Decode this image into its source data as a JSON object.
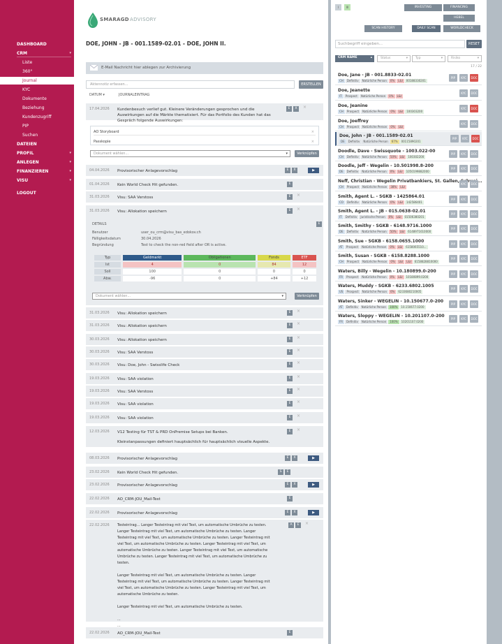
{
  "sidebar": {
    "items": [
      {
        "label": "DASHBOARD",
        "type": "main"
      },
      {
        "label": "CRM",
        "type": "main",
        "arrow": true
      },
      {
        "label": "Liste",
        "type": "sub"
      },
      {
        "label": "360°",
        "type": "sub"
      },
      {
        "label": "Journal",
        "type": "sub",
        "active": true
      },
      {
        "label": "KYC",
        "type": "sub"
      },
      {
        "label": "Dokumente",
        "type": "sub"
      },
      {
        "label": "Beziehung",
        "type": "sub"
      },
      {
        "label": "Kundenzugriff",
        "type": "sub"
      },
      {
        "label": "PIP",
        "type": "sub"
      },
      {
        "label": "Suchen",
        "type": "sub"
      },
      {
        "label": "DATEIEN",
        "type": "main"
      },
      {
        "label": "PROFIL",
        "type": "main",
        "arrow": true
      },
      {
        "label": "ANLEGEN",
        "type": "main",
        "arrow": true
      },
      {
        "label": "FINANZIEREN",
        "type": "main",
        "arrow": true
      },
      {
        "label": "VISU",
        "type": "main",
        "arrow": true
      },
      {
        "label": "LOGOUT",
        "type": "main",
        "gap": true
      }
    ]
  },
  "logo": {
    "brand": "SMARAGD",
    "suffix": "ADVISORY"
  },
  "page": {
    "title": "DOE, JOHN - JB - 001.1589-02.01 - DOE, JOHN II."
  },
  "banner": {
    "text": "E-Mail Nachricht hier ablegen zur Archivierung"
  },
  "note": {
    "placeholder": "Aktennotiz erfassen...",
    "create": "ERSTELLEN"
  },
  "table_head": {
    "date": "DATUM",
    "entry": "JOURNALEINTRAG"
  },
  "journal": [
    {
      "date": "17.04.2026",
      "text": "Kundenbesuch verlief gut. Kleinere Veränderungen gesprochen und die Auswirkungen auf die Märkte thematisiert. Für das Portfolio des Kunden hat das Gespräch folgende Auswirkungen:",
      "icons": [
        "E",
        "X"
      ],
      "expanded": "docs"
    },
    {
      "date": "04.04.2026",
      "text": "Provisorischer Anlagevorschlag",
      "icons": [
        "E",
        "X"
      ],
      "play": true
    },
    {
      "date": "01.04.2026",
      "text": "Kein World Check Hit gefunden.",
      "icons": [
        "E"
      ]
    },
    {
      "date": "31.03.2026",
      "text": "Visu: SAA Verstoss",
      "icons": [
        "E"
      ],
      "x": true
    },
    {
      "date": "31.03.2026",
      "text": "Visu: Allokation speichern",
      "icons": [
        "E"
      ],
      "x": true,
      "expanded": "detail"
    },
    {
      "date": "31.03.2026",
      "text": "Visu: Allokation speichern",
      "icons": [
        "E"
      ],
      "x": true
    },
    {
      "date": "31.03.2026",
      "text": "Visu: Allokation speichern",
      "icons": [
        "E"
      ],
      "x": true
    },
    {
      "date": "30.03.2026",
      "text": "Visu: Allokation speichern",
      "icons": [
        "E"
      ],
      "x": true
    },
    {
      "date": "30.03.2026",
      "text": "Visu: SAA Verstoss",
      "icons": [
        "E"
      ],
      "x": true
    },
    {
      "date": "30.03.2026",
      "text": "Visu: Doe, John - Swisslife Check",
      "icons": [
        "E"
      ],
      "x": true
    },
    {
      "date": "19.03.2026",
      "text": "Visu: SAA violation",
      "icons": [
        "E"
      ],
      "x": true
    },
    {
      "date": "19.03.2026",
      "text": "Visu: SAA Verstoss",
      "icons": [
        "E"
      ],
      "x": true
    },
    {
      "date": "19.03.2026",
      "text": "Visu: SAA violation",
      "icons": [
        "E"
      ],
      "x": true
    },
    {
      "date": "19.03.2026",
      "text": "Visu: SAA violation",
      "icons": [
        "E"
      ],
      "x": true
    },
    {
      "date": "12.03.2026",
      "text": "V12 Testing für TST & PRD OnPremise Setups bei Banken.",
      "text2": "Kleinstanpassungen definiert hauptsächlich für hauptsächlich visuelle Aspekte.",
      "icons": [
        "E"
      ],
      "x": true
    },
    {
      "date": "08.03.2026",
      "text": "Provisorischer Anlagevorschlag",
      "icons": [
        "E",
        "X"
      ],
      "play": true
    },
    {
      "date": "23.02.2026",
      "text": "Kein World Check Hit gefunden.",
      "icons": [
        "S",
        "E"
      ]
    },
    {
      "date": "23.02.2026",
      "text": "Provisorischer Anlagevorschlag",
      "icons": [
        "E",
        "X"
      ],
      "play": true
    },
    {
      "date": "22.02.2026",
      "text": "AO_CRM-JOU_Mail-Test",
      "icons": [
        "E"
      ]
    },
    {
      "date": "22.02.2026",
      "text": "Provisorischer Anlagevorschlag",
      "icons": [
        "E",
        "X"
      ],
      "play": true
    },
    {
      "date": "22.02.2026",
      "long": true,
      "icons": [
        "A",
        "E"
      ],
      "x": true
    },
    {
      "date": "22.02.2026",
      "text": "AO_CRM-JOU_Mail-Test",
      "icons": [
        "E"
      ]
    }
  ],
  "longtext": {
    "p1": "Testeintrag... Langer Testeintrag mit viel Text, um automatische Umbrüche zu testen. Langer Testeintrag mit viel Text, um automatische Umbrüche zu testen. Langer Testeintrag mit viel Text, um automatische Umbrüche zu testen. Langer Testeintrag mit viel Text, um automatische Umbrüche zu testen. Langer Testeintrag mit viel Text, um automatische Umbrüche zu testen. Langer Testeintrag mit viel Text, um automatische Umbrüche zu testen. Langer Testeintrag mit viel Text, um automatische Umbrüche zu testen.",
    "p2": "Langer Testeintrag mit viel Text, um automatische Umbrüche zu testen. Langer Testeintrag mit viel Text, um automatische Umbrüche zu testen. Langer Testeintrag mit viel Text, um automatische Umbrüche zu testen. Langer Testeintrag mit viel Text, um automatische Umbrüche zu testen.",
    "p3": "Langer Testeintrag mit viel Text, um automatische Umbrüche zu testen.",
    "p4": "...",
    "p5": "..."
  },
  "docs": {
    "items": [
      "AO Storyboard",
      "Passkopie"
    ],
    "select_placeholder": "Dokument wählen...",
    "link": "Verknüpfen"
  },
  "detail": {
    "title": "DETAILS",
    "fields": [
      {
        "label": "Benutzer",
        "value": "user_ou_crm@visu_bas_edokov.ch"
      },
      {
        "label": "Fälligkeitsdatum",
        "value": "30.04.2026"
      },
      {
        "label": "Begründung",
        "value": "Test to check the non-red field after OR is active."
      }
    ],
    "alloc_headers": [
      "Typ",
      "Geldmarkt",
      "Obligationen",
      "Fonds",
      "ETF"
    ],
    "alloc_rows": [
      [
        "Ist",
        "4",
        "0",
        "84",
        "12"
      ],
      [
        "Soll",
        "100",
        "0",
        "0",
        "0"
      ],
      [
        "Abw.",
        "-96",
        "0",
        "+84",
        "+12"
      ]
    ],
    "header_colors": [
      "#d6dce2",
      "#2e5a8a",
      "#5cb85c",
      "#d8d84a",
      "#d9534f"
    ],
    "select_placeholder": "Dokument wählen...",
    "link": "Verknüpfen"
  },
  "right": {
    "nav_small": [
      "I",
      "III"
    ],
    "top_buttons": [
      "INVESTING",
      "FINANCING",
      "HEBEL",
      "SCAN HISTORY",
      "DAILY SCAN",
      "WORLDCHECK"
    ],
    "search_placeholder": "Suchbegriff eingeben...",
    "search_btn": "RESET",
    "filters": [
      "CRM NAME",
      "Status",
      "Typ",
      "Risiko"
    ],
    "count": "17 / 22",
    "items": [
      {
        "name": "Doe, Jane - JB - 001.8833-02.01",
        "tags": [
          "CH",
          "Definitiv",
          "Natürliche Person",
          "0%",
          "L&I",
          "00188330201"
        ],
        "pct": "r",
        "btns": [
          "PIP",
          "KYC",
          "DOC"
        ],
        "doc": "red"
      },
      {
        "name": "Doe, Jeanette",
        "tags": [
          "IT",
          "Prospect",
          "Natürliche Person",
          "0%",
          "L&I"
        ],
        "pct": "r",
        "btns": [
          "KYC",
          "DOC"
        ],
        "doc": "dark"
      },
      {
        "name": "Doe, Jeanine",
        "tags": [
          "CH",
          "Prospect",
          "Natürliche Person",
          "0%",
          "L&I",
          "100303200"
        ],
        "pct": "r",
        "btns": [
          "KYC",
          "DOC"
        ],
        "doc": "red"
      },
      {
        "name": "Doe, Joeffrey",
        "tags": [
          "CH",
          "Prospect",
          "Natürliche Person",
          "0%",
          "L&I"
        ],
        "pct": "r",
        "btns": [
          "KYC",
          "DOC"
        ],
        "doc": "dark"
      },
      {
        "name": "Doe, John - JB - 001.1589-02.01",
        "tags": [
          "DE",
          "Definitiv",
          "Natürliche Person",
          "67%",
          "00115890201"
        ],
        "pct": "y",
        "btns": [
          "PIP",
          "KYC",
          "DOC"
        ],
        "doc": "red",
        "hl": true
      },
      {
        "name": "Doodle, Dave - Swissquote - 1003.022-00",
        "tags": [
          "CH",
          "Definitiv",
          "Natürliche Person",
          "50%",
          "L&I",
          "100302200"
        ],
        "pct": "r",
        "btns": [
          "PIP",
          "KYC",
          "DOC"
        ],
        "doc": "dark"
      },
      {
        "name": "Doodle, Jeff - Wegelin - 10.501998.8-200",
        "tags": [
          "DE",
          "Definitiv",
          "Natürliche Person",
          "0%",
          "L&I",
          "1050199882000"
        ],
        "pct": "r",
        "btns": [
          "PIP",
          "KYC",
          "DOC"
        ],
        "doc": "dark"
      },
      {
        "name": "Neff, Christian - Wegelin Privatbankiers, St. Gallen, Schwei...",
        "tags": [
          "CH",
          "Prospect",
          "Natürliche Person",
          "38%",
          "L&I"
        ],
        "pct": "r",
        "btns": [
          "KYC",
          "DOC"
        ],
        "doc": "dark"
      },
      {
        "name": "Smith, Agent L. - SGKB - 1425864.01",
        "tags": [
          "CO",
          "Definitiv",
          "Natürliche Person",
          "0%",
          "L&I",
          "142586401"
        ],
        "pct": "r",
        "btns": [
          "PIP",
          "KYC",
          "DOC"
        ],
        "doc": "dark"
      },
      {
        "name": "Smith, Agent L. - JB - 015.0638-02.01",
        "tags": [
          "IT",
          "Definitiv",
          "Juristische Person",
          "0%",
          "L&I",
          "01506380201"
        ],
        "pct": "r",
        "btns": [
          "PIP",
          "KYC",
          "DOC"
        ],
        "doc": "dark"
      },
      {
        "name": "Smith, Smithy - SGKB - 6148.9716.1000",
        "tags": [
          "DE",
          "Definitiv",
          "Natürliche Person",
          "50%",
          "L&I",
          "6148971610000"
        ],
        "pct": "r",
        "btns": [
          "PIP",
          "KYC",
          "DOC"
        ],
        "doc": "dark"
      },
      {
        "name": "Smith, Sue - SGKB - 6158.0655.1000",
        "tags": [
          "AT",
          "Prospect",
          "Natürliche Person",
          "0%",
          "L&I",
          "6158065510..."
        ],
        "pct": "r",
        "btns": [
          "PIP",
          "KYC",
          "DOC"
        ],
        "doc": "dark"
      },
      {
        "name": "Smith, Susan - SGKB - 6158.8288.1000",
        "tags": [
          "CH",
          "Prospect",
          "Natürliche Person",
          "0%",
          "L&I",
          "L&I",
          "6158828810000"
        ],
        "pct": "r",
        "btns": [
          "PIP",
          "KYC",
          "DOC"
        ],
        "doc": "dark"
      },
      {
        "name": "Waters, Billy - Wegelin - 10.180899.0-200",
        "tags": [
          "FR",
          "Prospect",
          "Natürliche Person",
          "0%",
          "L&I",
          "10180899.0200"
        ],
        "pct": "r",
        "btns": [
          "PIP",
          "KYC",
          "DOC"
        ],
        "doc": "dark"
      },
      {
        "name": "Waters, Muddy - SGKB - 6233.6802.1005",
        "tags": [
          "US",
          "Prospect",
          "Natürliche Person",
          "0%",
          "6233680210005"
        ],
        "pct": "r",
        "btns": [
          "PIP",
          "KYC",
          "DOC"
        ],
        "doc": "dark"
      },
      {
        "name": "Waters, Sinker - WEGELIN - 10.150677.0-200",
        "tags": [
          "AT",
          "Definitiv",
          "Natürliche Person",
          "100%",
          "10.150677.0200"
        ],
        "pct": "g",
        "btns": [
          "PIP",
          "KYC",
          "DOC"
        ],
        "doc": "dark"
      },
      {
        "name": "Waters, Sloppy - WEGELIN - 10.201107.0-200",
        "tags": [
          "FR",
          "Definitiv",
          "Natürliche Person",
          "100%",
          "10201107.0200"
        ],
        "pct": "g",
        "btns": [
          "PIP",
          "KYC",
          "DOC"
        ],
        "doc": "dark"
      }
    ]
  },
  "colors": {
    "brand": "#b31b50",
    "accent": "#3d5a80",
    "muted": "#7e8b97",
    "light": "#e9ecef"
  }
}
